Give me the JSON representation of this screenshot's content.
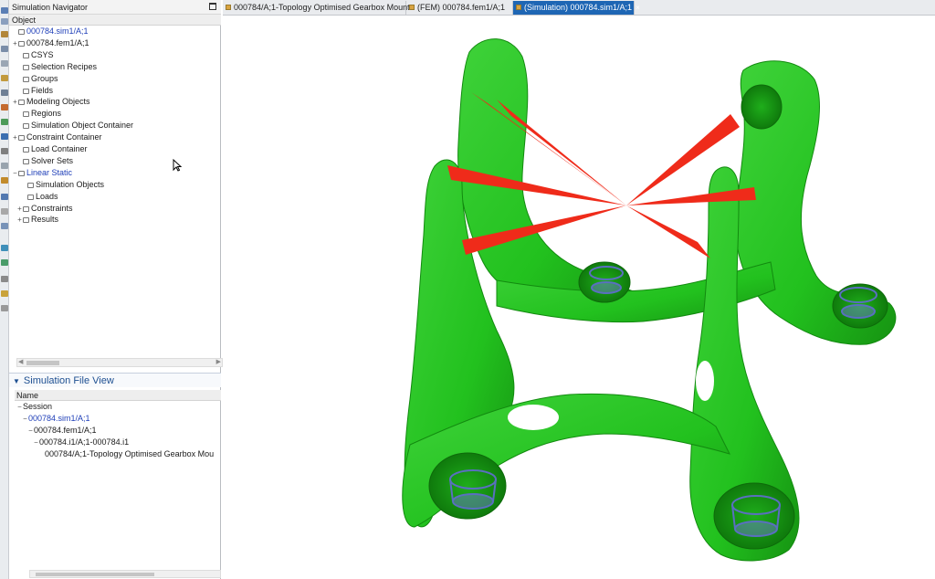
{
  "navigator": {
    "title": "Simulation Navigator",
    "column_header": "Object",
    "tree": [
      {
        "label": "000784.sim1/A;1",
        "depth": 0,
        "expander": "",
        "style": "blue"
      },
      {
        "label": "000784.fem1/A;1",
        "depth": 0,
        "expander": "+",
        "style": "normal"
      },
      {
        "label": "CSYS",
        "depth": 1,
        "expander": "",
        "style": "normal"
      },
      {
        "label": "Selection Recipes",
        "depth": 1,
        "expander": "",
        "style": "normal"
      },
      {
        "label": "Groups",
        "depth": 1,
        "expander": "",
        "style": "normal"
      },
      {
        "label": "Fields",
        "depth": 1,
        "expander": "",
        "style": "normal"
      },
      {
        "label": "Modeling Objects",
        "depth": 0,
        "expander": "+",
        "style": "normal"
      },
      {
        "label": "Regions",
        "depth": 1,
        "expander": "",
        "style": "normal"
      },
      {
        "label": "Simulation Object Container",
        "depth": 1,
        "expander": "",
        "style": "normal"
      },
      {
        "label": "Constraint Container",
        "depth": 0,
        "expander": "+",
        "style": "normal"
      },
      {
        "label": "Load Container",
        "depth": 1,
        "expander": "",
        "style": "normal"
      },
      {
        "label": "Solver Sets",
        "depth": 1,
        "expander": "",
        "style": "normal"
      },
      {
        "label": "Linear Static",
        "depth": 0,
        "expander": "−",
        "style": "blue"
      },
      {
        "label": "Simulation Objects",
        "depth": 2,
        "expander": "",
        "style": "normal"
      },
      {
        "label": "Loads",
        "depth": 2,
        "expander": "",
        "style": "normal"
      },
      {
        "label": "Constraints",
        "depth": 1,
        "expander": "+",
        "style": "normal"
      },
      {
        "label": "Results",
        "depth": 1,
        "expander": "+",
        "style": "normal"
      }
    ]
  },
  "file_view": {
    "title": "Simulation File View",
    "column_header": "Name",
    "items": [
      {
        "label": "Session",
        "depth": 0,
        "expander": "−",
        "style": "normal"
      },
      {
        "label": "000784.sim1/A;1",
        "depth": 1,
        "expander": "−",
        "style": "blue"
      },
      {
        "label": "000784.fem1/A;1",
        "depth": 2,
        "expander": "−",
        "style": "normal"
      },
      {
        "label": "000784.i1/A;1-000784.i1",
        "depth": 3,
        "expander": "−",
        "style": "normal"
      },
      {
        "label": "000784/A;1-Topology Optimised Gearbox Mou",
        "depth": 4,
        "expander": "",
        "style": "normal"
      }
    ]
  },
  "tabs": [
    {
      "label": "000784/A;1-Topology Optimised Gearbox Mount",
      "active": false
    },
    {
      "label": "(FEM) 000784.fem1/A;1",
      "active": false
    },
    {
      "label": "(Simulation) 000784.sim1/A;1",
      "active": true
    }
  ],
  "icons": {
    "tab_close": "×",
    "collapse": "▼"
  },
  "colors": {
    "part": "#22c11e",
    "part_shade": "#169312",
    "load_arrows": "#ef2b1a",
    "constraints": "#5a6fc0",
    "active_tab": "#1e66b4"
  }
}
